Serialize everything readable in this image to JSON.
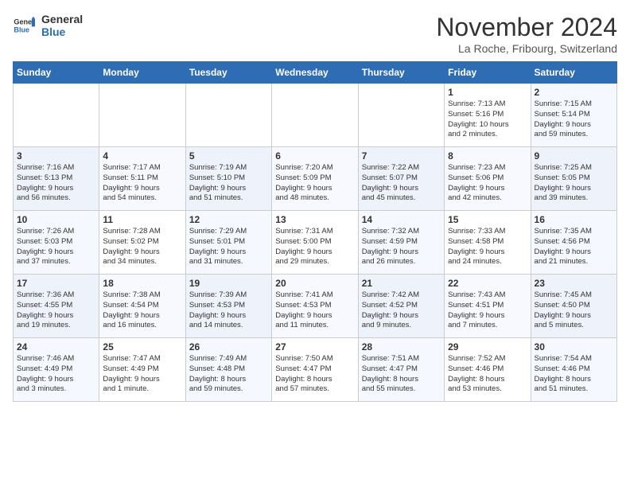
{
  "header": {
    "logo_line1": "General",
    "logo_line2": "Blue",
    "month_title": "November 2024",
    "location": "La Roche, Fribourg, Switzerland"
  },
  "weekdays": [
    "Sunday",
    "Monday",
    "Tuesday",
    "Wednesday",
    "Thursday",
    "Friday",
    "Saturday"
  ],
  "weeks": [
    [
      {
        "day": "",
        "info": ""
      },
      {
        "day": "",
        "info": ""
      },
      {
        "day": "",
        "info": ""
      },
      {
        "day": "",
        "info": ""
      },
      {
        "day": "",
        "info": ""
      },
      {
        "day": "1",
        "info": "Sunrise: 7:13 AM\nSunset: 5:16 PM\nDaylight: 10 hours\nand 2 minutes."
      },
      {
        "day": "2",
        "info": "Sunrise: 7:15 AM\nSunset: 5:14 PM\nDaylight: 9 hours\nand 59 minutes."
      }
    ],
    [
      {
        "day": "3",
        "info": "Sunrise: 7:16 AM\nSunset: 5:13 PM\nDaylight: 9 hours\nand 56 minutes."
      },
      {
        "day": "4",
        "info": "Sunrise: 7:17 AM\nSunset: 5:11 PM\nDaylight: 9 hours\nand 54 minutes."
      },
      {
        "day": "5",
        "info": "Sunrise: 7:19 AM\nSunset: 5:10 PM\nDaylight: 9 hours\nand 51 minutes."
      },
      {
        "day": "6",
        "info": "Sunrise: 7:20 AM\nSunset: 5:09 PM\nDaylight: 9 hours\nand 48 minutes."
      },
      {
        "day": "7",
        "info": "Sunrise: 7:22 AM\nSunset: 5:07 PM\nDaylight: 9 hours\nand 45 minutes."
      },
      {
        "day": "8",
        "info": "Sunrise: 7:23 AM\nSunset: 5:06 PM\nDaylight: 9 hours\nand 42 minutes."
      },
      {
        "day": "9",
        "info": "Sunrise: 7:25 AM\nSunset: 5:05 PM\nDaylight: 9 hours\nand 39 minutes."
      }
    ],
    [
      {
        "day": "10",
        "info": "Sunrise: 7:26 AM\nSunset: 5:03 PM\nDaylight: 9 hours\nand 37 minutes."
      },
      {
        "day": "11",
        "info": "Sunrise: 7:28 AM\nSunset: 5:02 PM\nDaylight: 9 hours\nand 34 minutes."
      },
      {
        "day": "12",
        "info": "Sunrise: 7:29 AM\nSunset: 5:01 PM\nDaylight: 9 hours\nand 31 minutes."
      },
      {
        "day": "13",
        "info": "Sunrise: 7:31 AM\nSunset: 5:00 PM\nDaylight: 9 hours\nand 29 minutes."
      },
      {
        "day": "14",
        "info": "Sunrise: 7:32 AM\nSunset: 4:59 PM\nDaylight: 9 hours\nand 26 minutes."
      },
      {
        "day": "15",
        "info": "Sunrise: 7:33 AM\nSunset: 4:58 PM\nDaylight: 9 hours\nand 24 minutes."
      },
      {
        "day": "16",
        "info": "Sunrise: 7:35 AM\nSunset: 4:56 PM\nDaylight: 9 hours\nand 21 minutes."
      }
    ],
    [
      {
        "day": "17",
        "info": "Sunrise: 7:36 AM\nSunset: 4:55 PM\nDaylight: 9 hours\nand 19 minutes."
      },
      {
        "day": "18",
        "info": "Sunrise: 7:38 AM\nSunset: 4:54 PM\nDaylight: 9 hours\nand 16 minutes."
      },
      {
        "day": "19",
        "info": "Sunrise: 7:39 AM\nSunset: 4:53 PM\nDaylight: 9 hours\nand 14 minutes."
      },
      {
        "day": "20",
        "info": "Sunrise: 7:41 AM\nSunset: 4:53 PM\nDaylight: 9 hours\nand 11 minutes."
      },
      {
        "day": "21",
        "info": "Sunrise: 7:42 AM\nSunset: 4:52 PM\nDaylight: 9 hours\nand 9 minutes."
      },
      {
        "day": "22",
        "info": "Sunrise: 7:43 AM\nSunset: 4:51 PM\nDaylight: 9 hours\nand 7 minutes."
      },
      {
        "day": "23",
        "info": "Sunrise: 7:45 AM\nSunset: 4:50 PM\nDaylight: 9 hours\nand 5 minutes."
      }
    ],
    [
      {
        "day": "24",
        "info": "Sunrise: 7:46 AM\nSunset: 4:49 PM\nDaylight: 9 hours\nand 3 minutes."
      },
      {
        "day": "25",
        "info": "Sunrise: 7:47 AM\nSunset: 4:49 PM\nDaylight: 9 hours\nand 1 minute."
      },
      {
        "day": "26",
        "info": "Sunrise: 7:49 AM\nSunset: 4:48 PM\nDaylight: 8 hours\nand 59 minutes."
      },
      {
        "day": "27",
        "info": "Sunrise: 7:50 AM\nSunset: 4:47 PM\nDaylight: 8 hours\nand 57 minutes."
      },
      {
        "day": "28",
        "info": "Sunrise: 7:51 AM\nSunset: 4:47 PM\nDaylight: 8 hours\nand 55 minutes."
      },
      {
        "day": "29",
        "info": "Sunrise: 7:52 AM\nSunset: 4:46 PM\nDaylight: 8 hours\nand 53 minutes."
      },
      {
        "day": "30",
        "info": "Sunrise: 7:54 AM\nSunset: 4:46 PM\nDaylight: 8 hours\nand 51 minutes."
      }
    ]
  ]
}
